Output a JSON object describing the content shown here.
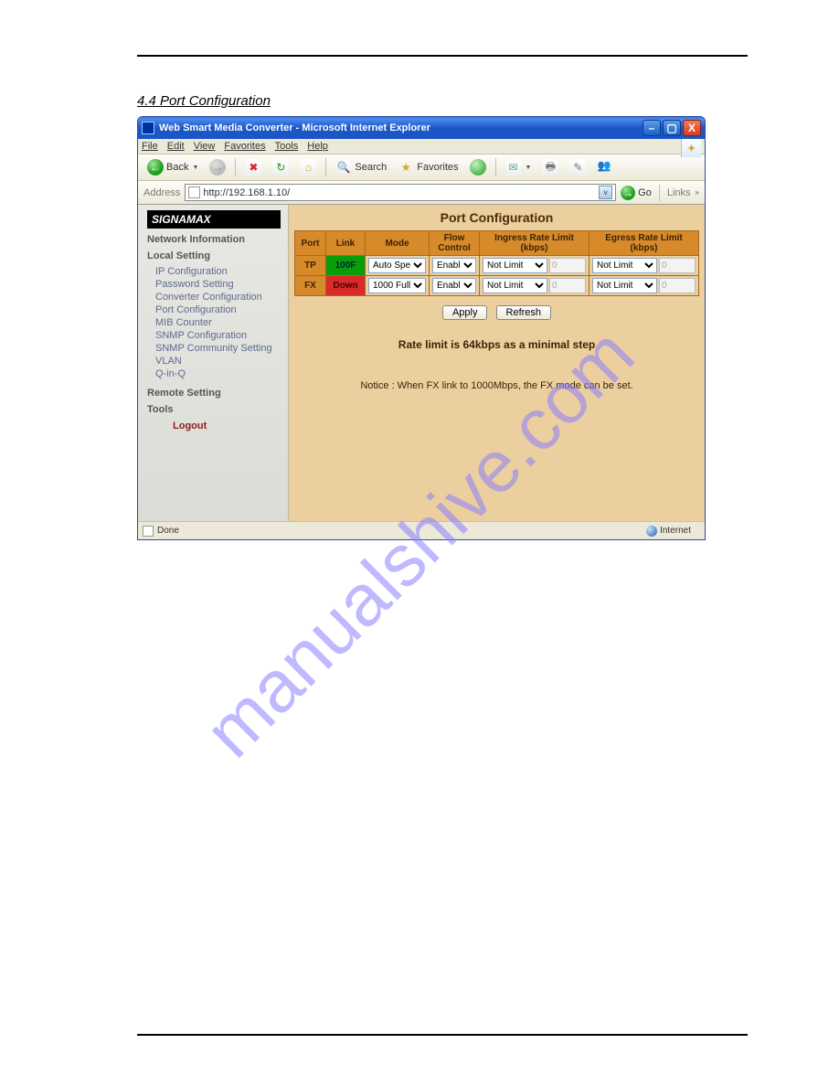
{
  "document": {
    "section_title": "4.4 Port Configuration",
    "watermark": "manualshive.com"
  },
  "window": {
    "title": "Web Smart Media Converter - Microsoft Internet Explorer",
    "min_glyph": "–",
    "max_glyph": "▢",
    "close_glyph": "X"
  },
  "menu": {
    "file": "File",
    "edit": "Edit",
    "view": "View",
    "favorites": "Favorites",
    "tools": "Tools",
    "help": "Help"
  },
  "toolbar": {
    "back": "Back",
    "search": "Search",
    "favorites": "Favorites"
  },
  "address": {
    "label": "Address",
    "url": "http://192.168.1.10/",
    "go": "Go",
    "links": "Links"
  },
  "sidebar": {
    "logo": "SIGNAMAX",
    "h1": "Network Information",
    "h2": "Local Setting",
    "items": [
      "IP Configuration",
      "Password Setting",
      "Converter Configuration",
      "Port Configuration",
      "MIB Counter",
      "SNMP Configuration",
      "SNMP Community Setting",
      "VLAN",
      "Q-in-Q"
    ],
    "h3": "Remote Setting",
    "h4": "Tools",
    "logout": "Logout"
  },
  "page": {
    "heading": "Port Configuration",
    "headers": {
      "port": "Port",
      "link": "Link",
      "mode": "Mode",
      "flow": "Flow Control",
      "ingress": "Ingress Rate Limit (kbps)",
      "egress": "Egress Rate Limit (kbps)"
    },
    "rows": [
      {
        "port": "TP",
        "link": "100F",
        "link_state": "up",
        "mode": "Auto Speed",
        "flow": "Enable",
        "ingress_sel": "Not Limit",
        "ingress_val": "0",
        "egress_sel": "Not Limit",
        "egress_val": "0"
      },
      {
        "port": "FX",
        "link": "Down",
        "link_state": "down",
        "mode": "1000 Full",
        "flow": "Enable",
        "ingress_sel": "Not Limit",
        "ingress_val": "0",
        "egress_sel": "Not Limit",
        "egress_val": "0"
      }
    ],
    "apply": "Apply",
    "refresh": "Refresh",
    "rate_notice": "Rate limit is 64kbps as a minimal step",
    "fx_notice": "Notice : When FX link to 1000Mbps, the FX mode can be set."
  },
  "status": {
    "left": "Done",
    "zone": "Internet"
  }
}
